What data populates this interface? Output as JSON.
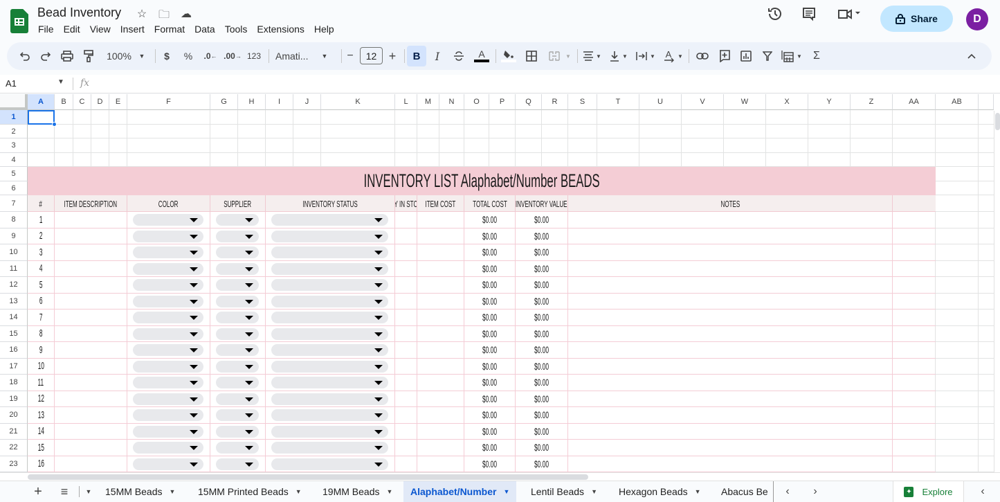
{
  "app": {
    "title": "Bead Inventory",
    "menu": [
      "File",
      "Edit",
      "View",
      "Insert",
      "Format",
      "Data",
      "Tools",
      "Extensions",
      "Help"
    ],
    "share_label": "Share",
    "avatar_initial": "D",
    "colors": {
      "accent": "#0b57d0",
      "share_bg": "#c2e7ff",
      "avatar": "#7b1fa2",
      "sheet_green": "#188038",
      "title_band": "#f4cdd5",
      "header_row": "#f5eeee"
    }
  },
  "toolbar": {
    "zoom": "100%",
    "currency": "$",
    "percent": "%",
    "decrease_decimal": ".0",
    "increase_decimal": ".00",
    "number_format": "123",
    "font": "Amati...",
    "font_size": "12",
    "minus": "−",
    "plus": "+",
    "bold": "B",
    "italic": "I",
    "sigma": "Σ"
  },
  "formula_bar": {
    "cell_ref": "A1",
    "fx": "fx",
    "value": ""
  },
  "columns": [
    "A",
    "B",
    "C",
    "D",
    "E",
    "F",
    "G",
    "H",
    "I",
    "J",
    "K",
    "L",
    "M",
    "N",
    "O",
    "P",
    "Q",
    "R",
    "S",
    "T",
    "U",
    "V",
    "W",
    "X",
    "Y",
    "Z",
    "AA",
    "AB"
  ],
  "rows": [
    "1",
    "2",
    "3",
    "4",
    "5",
    "6",
    "7",
    "8",
    "9",
    "10",
    "11",
    "12",
    "13",
    "14",
    "15",
    "16",
    "17",
    "18",
    "19",
    "20",
    "21",
    "22",
    "23"
  ],
  "sheet": {
    "title": "INVENTORY LIST Alaphabet/Number BEADS",
    "headers": [
      "#",
      "Item Description",
      "Color",
      "Supplier",
      "Inventory Status",
      "QTY in Stock",
      "Item Cost",
      "Total Cost",
      "Inventory Value",
      "Notes"
    ],
    "items": [
      {
        "num": "1",
        "total_cost": "$0.00",
        "inventory_value": "$0.00"
      },
      {
        "num": "2",
        "total_cost": "$0.00",
        "inventory_value": "$0.00"
      },
      {
        "num": "3",
        "total_cost": "$0.00",
        "inventory_value": "$0.00"
      },
      {
        "num": "4",
        "total_cost": "$0.00",
        "inventory_value": "$0.00"
      },
      {
        "num": "5",
        "total_cost": "$0.00",
        "inventory_value": "$0.00"
      },
      {
        "num": "6",
        "total_cost": "$0.00",
        "inventory_value": "$0.00"
      },
      {
        "num": "7",
        "total_cost": "$0.00",
        "inventory_value": "$0.00"
      },
      {
        "num": "8",
        "total_cost": "$0.00",
        "inventory_value": "$0.00"
      },
      {
        "num": "9",
        "total_cost": "$0.00",
        "inventory_value": "$0.00"
      },
      {
        "num": "10",
        "total_cost": "$0.00",
        "inventory_value": "$0.00"
      },
      {
        "num": "11",
        "total_cost": "$0.00",
        "inventory_value": "$0.00"
      },
      {
        "num": "12",
        "total_cost": "$0.00",
        "inventory_value": "$0.00"
      },
      {
        "num": "13",
        "total_cost": "$0.00",
        "inventory_value": "$0.00"
      },
      {
        "num": "14",
        "total_cost": "$0.00",
        "inventory_value": "$0.00"
      },
      {
        "num": "15",
        "total_cost": "$0.00",
        "inventory_value": "$0.00"
      },
      {
        "num": "16",
        "total_cost": "$0.00",
        "inventory_value": "$0.00"
      }
    ]
  },
  "tabs": [
    {
      "label": "15MM Beads",
      "active": false
    },
    {
      "label": "15MM Printed Beads",
      "active": false
    },
    {
      "label": "19MM Beads",
      "active": false
    },
    {
      "label": "Alaphabet/Number",
      "active": true
    },
    {
      "label": "Lentil Beads",
      "active": false
    },
    {
      "label": "Hexagon Beads",
      "active": false
    },
    {
      "label": "Abacus Be",
      "active": false
    }
  ],
  "explore_label": "Explore"
}
